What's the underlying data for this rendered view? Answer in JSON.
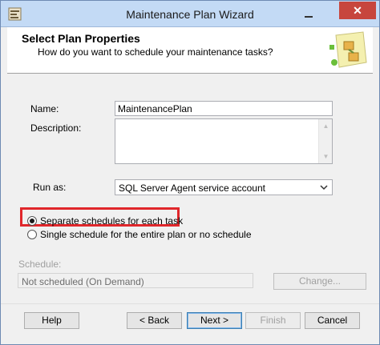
{
  "window": {
    "title": "Maintenance Plan Wizard",
    "close_glyph": "✕",
    "app_icon": "wizard-app-icon"
  },
  "header": {
    "title": "Select Plan Properties",
    "subtitle": "How do you want to schedule your maintenance tasks?"
  },
  "form": {
    "name_label": "Name:",
    "name_value": "MaintenancePlan",
    "description_label": "Description:",
    "description_value": "",
    "run_as_label": "Run as:",
    "run_as_value": "SQL Server Agent service account"
  },
  "schedule_options": [
    {
      "label": "Separate schedules for each task",
      "checked": true
    },
    {
      "label": "Single schedule for the entire plan or no schedule",
      "checked": false
    }
  ],
  "schedule": {
    "label": "Schedule:",
    "value": "Not scheduled (On Demand)",
    "change_button": "Change..."
  },
  "buttons": {
    "help": "Help",
    "back": "< Back",
    "next": "Next >",
    "finish": "Finish",
    "cancel": "Cancel"
  },
  "colors": {
    "highlight": "#e0272b",
    "titlebar": "#c3daf5",
    "close_button": "#c7463d"
  }
}
